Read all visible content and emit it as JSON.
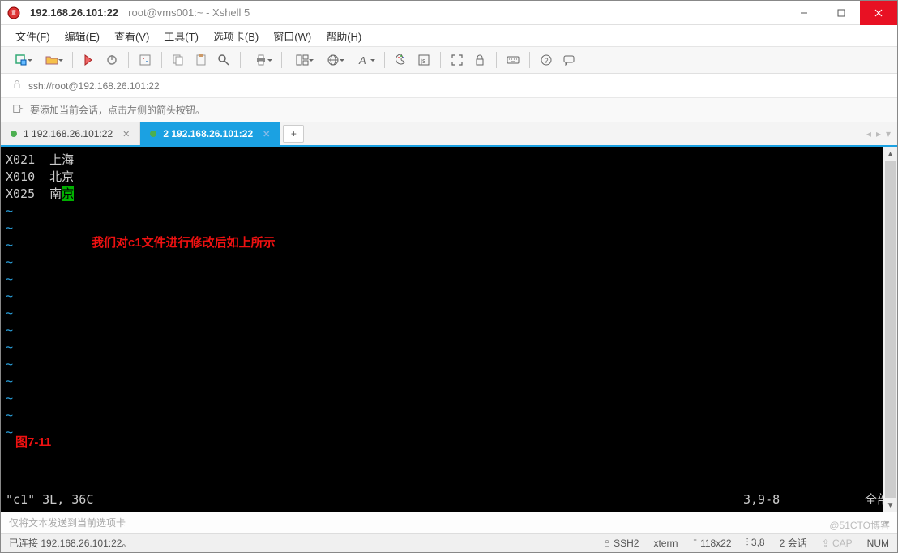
{
  "window": {
    "title_main": "192.168.26.101:22",
    "title_sub": "root@vms001:~ - Xshell 5"
  },
  "menu": {
    "file": "文件(F)",
    "edit": "编辑(E)",
    "view": "查看(V)",
    "tools": "工具(T)",
    "tabs": "选项卡(B)",
    "window": "窗口(W)",
    "help": "帮助(H)"
  },
  "address": {
    "url": "ssh://root@192.168.26.101:22"
  },
  "hint": {
    "text": "要添加当前会话，点击左侧的箭头按钮。"
  },
  "tabs": {
    "t1_prefix": "1",
    "t1_label": " 192.168.26.101:22",
    "t2_prefix": "2",
    "t2_label": " 192.168.26.101:22",
    "add": "+"
  },
  "terminal": {
    "line1": "X021  上海",
    "line2": "X010  北京",
    "line3_a": "X025  南",
    "line3_cursor": "京",
    "tilde": "~",
    "annotation1": "我们对c1文件进行修改后如上所示",
    "annotation2": "图7-11",
    "vim_left": "\"c1\" 3L, 36C",
    "vim_pos": "3,9-8",
    "vim_all": "全部"
  },
  "input": {
    "placeholder": "仅将文本发送到当前选项卡"
  },
  "status": {
    "conn": "已连接 192.168.26.101:22。",
    "ssh": "SSH2",
    "term": "xterm",
    "size": "118x22",
    "cur": "3,8",
    "sess": "2 会话",
    "caps": "CAP",
    "num": "NUM"
  },
  "watermark": "@51CTO博客"
}
